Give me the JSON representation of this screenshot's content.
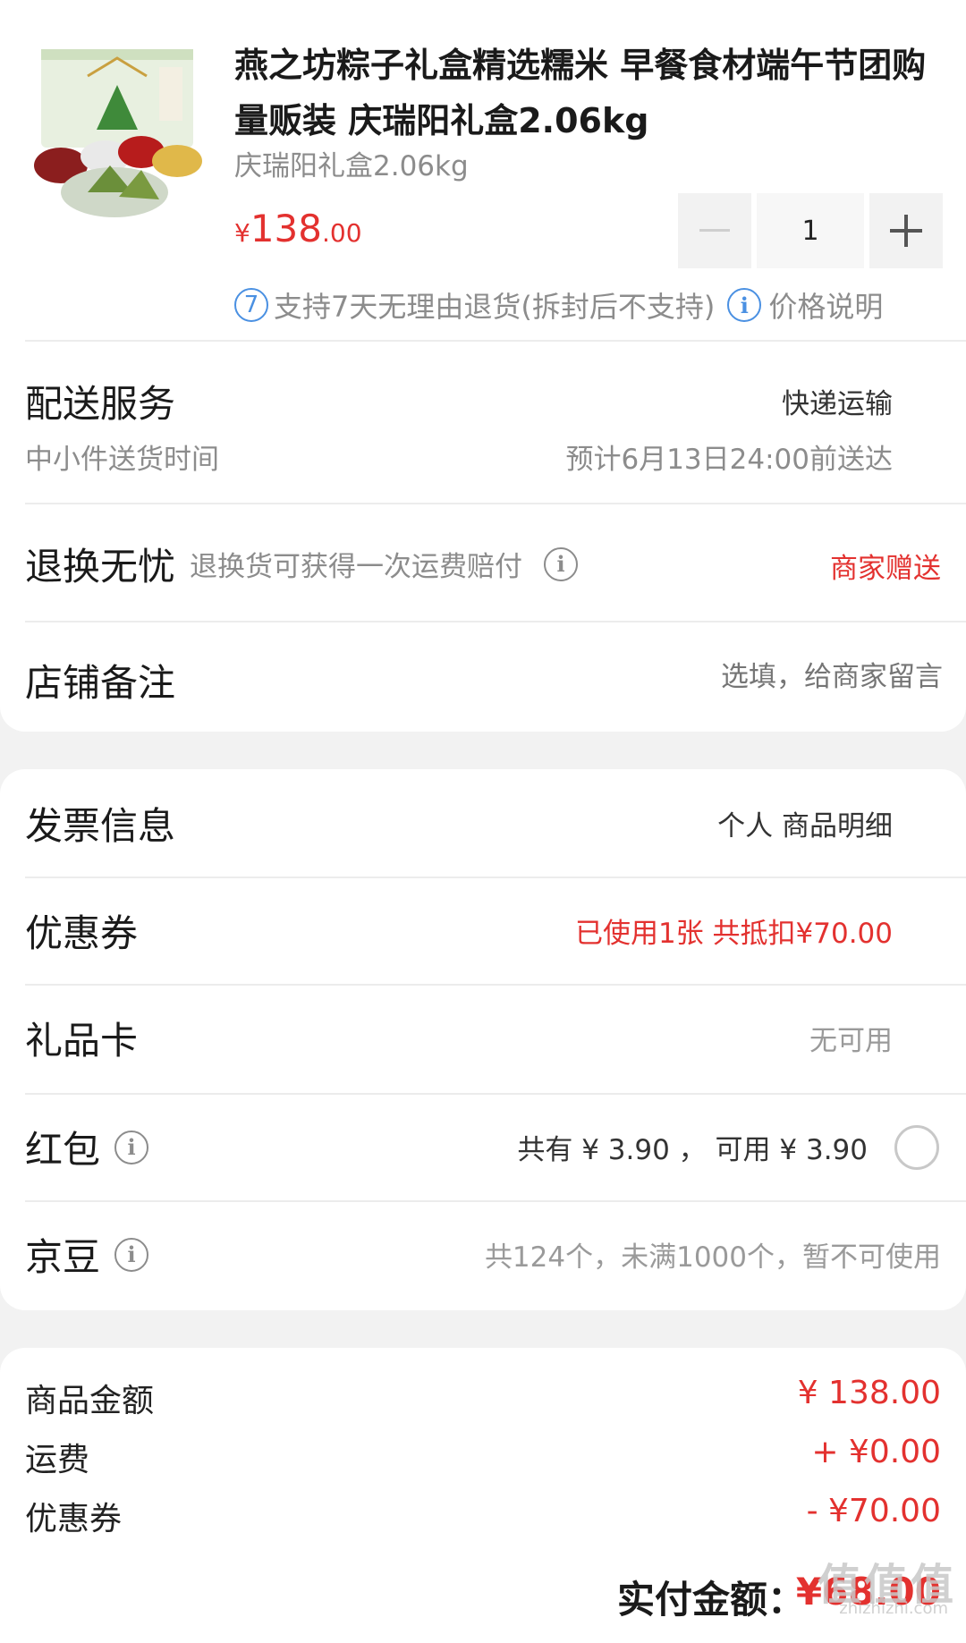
{
  "product": {
    "title": "燕之坊粽子礼盒精选糯米 早餐食材端午节团购量贩装 庆瑞阳礼盒2.06kg",
    "spec": "庆瑞阳礼盒2.06kg",
    "price_currency": "¥",
    "price_int": "138",
    "price_dec": ".00",
    "quantity": "1",
    "minus_symbol": "−",
    "plus_symbol": "+",
    "return_badge": "7",
    "return_policy": "支持7天无理由退货(拆封后不支持)",
    "price_note": "价格说明",
    "info_glyph": "i"
  },
  "delivery": {
    "label": "配送服务",
    "method": "快递运输",
    "sub_label": "中小件送货时间",
    "eta": "预计6月13日24:00前送达"
  },
  "exchange": {
    "label": "退换无忧",
    "desc": "退换货可获得一次运费赔付",
    "value": "商家赠送"
  },
  "remark": {
    "label": "店铺备注",
    "placeholder": "选填，给商家留言"
  },
  "invoice": {
    "label": "发票信息",
    "value": "个人 商品明细"
  },
  "coupon": {
    "label": "优惠券",
    "value": "已使用1张 共抵扣¥70.00"
  },
  "giftcard": {
    "label": "礼品卡",
    "value": "无可用"
  },
  "redpacket": {
    "label": "红包",
    "value": "共有 ¥ 3.90 ， 可用 ¥ 3.90"
  },
  "jingdou": {
    "label": "京豆",
    "value": "共124个，未满1000个，暂不可使用"
  },
  "summary": {
    "goods_label": "商品金额",
    "goods_value": "¥ 138.00",
    "shipping_label": "运费",
    "shipping_value": "+ ¥0.00",
    "coupon_label": "优惠券",
    "coupon_value": "- ¥70.00",
    "total_label": "实付金额：",
    "total_value": "¥68.00"
  },
  "watermark": {
    "main": "值值值",
    "sub": "zhizhizhi.com"
  },
  "colors": {
    "accent_red": "#e3312f",
    "info_blue": "#4a90e2"
  }
}
